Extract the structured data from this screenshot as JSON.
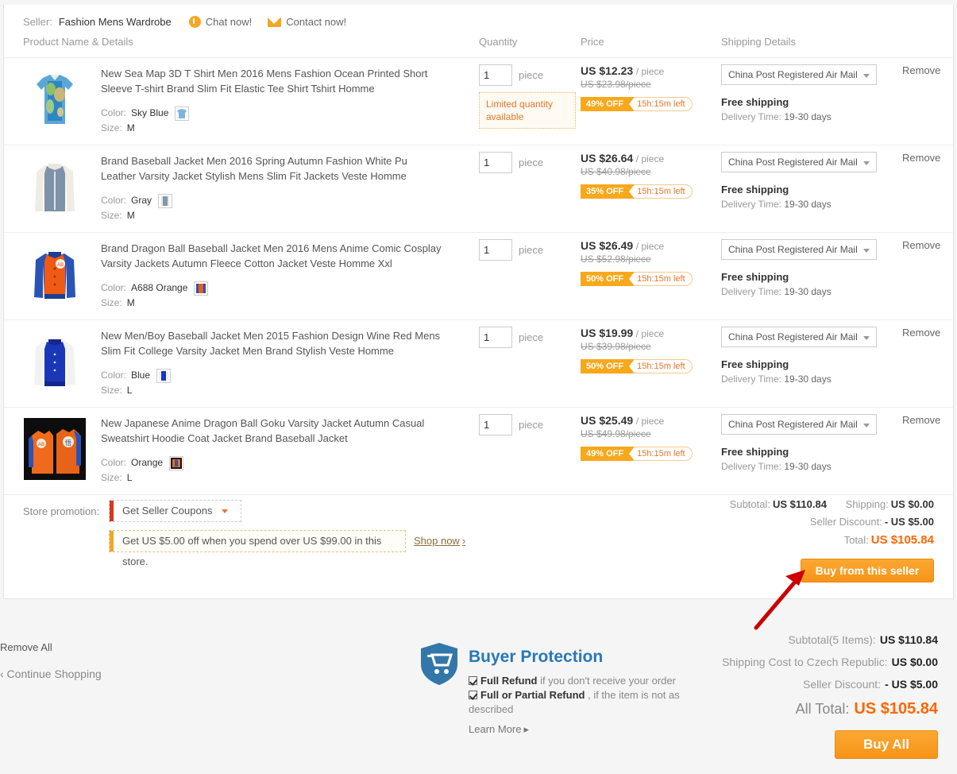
{
  "seller": {
    "label": "Seller:",
    "name": "Fashion Mens Wardrobe",
    "chat_label": "Chat now!",
    "contact_label": "Contact now!"
  },
  "columns": {
    "product": "Product Name & Details",
    "quantity": "Quantity",
    "price": "Price",
    "shipping": "Shipping Details"
  },
  "common": {
    "remove": "Remove",
    "unit": "piece",
    "per_piece": "/ piece",
    "free_shipping": "Free shipping",
    "delivery_key": "Delivery Time:",
    "delivery_value": "19-30 days",
    "color_key": "Color:",
    "size_key": "Size:",
    "limited_quantity": "Limited quantity available"
  },
  "items": [
    {
      "name": "New Sea Map 3D T Shirt Men 2016 Mens Fashion Ocean Printed Short Sleeve T-shirt Brand Slim Fit Elastic Tee Shirt Tshirt Homme",
      "color": "Sky Blue",
      "size": "M",
      "qty": "1",
      "price": "US $12.23",
      "original_price": "US $23.98/piece",
      "discount": "49% OFF",
      "time_left": "15h:15m left",
      "shipping_method": "China Post Registered Air Mail",
      "limited": true,
      "thumb": "tshirt-sea-map"
    },
    {
      "name": "Brand Baseball Jacket Men 2016 Spring Autumn Fashion White Pu Leather Varsity Jacket Stylish Mens Slim Fit Jackets Veste Homme",
      "color": "Gray",
      "size": "M",
      "qty": "1",
      "price": "US $26.64",
      "original_price": "US $40.98/piece",
      "discount": "35% OFF",
      "time_left": "15h:15m left",
      "shipping_method": "China Post Registered Air Mail",
      "limited": false,
      "thumb": "jacket-gray"
    },
    {
      "name": "Brand Dragon Ball Baseball Jacket Men 2016 Mens Anime Comic Cosplay Varsity Jackets Autumn Fleece Cotton Jacket Veste Homme Xxl",
      "color": "A688 Orange",
      "size": "M",
      "qty": "1",
      "price": "US $26.49",
      "original_price": "US $52.98/piece",
      "discount": "50% OFF",
      "time_left": "15h:15m left",
      "shipping_method": "China Post Registered Air Mail",
      "limited": false,
      "thumb": "jacket-orange-blue"
    },
    {
      "name": "New Men/Boy Baseball Jacket Men 2015 Fashion Design Wine Red Mens Slim Fit College Varsity Jacket Men Brand Stylish Veste Homme",
      "color": "Blue",
      "size": "L",
      "qty": "1",
      "price": "US $19.99",
      "original_price": "US $39.98/piece",
      "discount": "50% OFF",
      "time_left": "15h:15m left",
      "shipping_method": "China Post Registered Air Mail",
      "limited": false,
      "thumb": "jacket-blue-white"
    },
    {
      "name": "New Japanese Anime Dragon Ball Goku Varsity Jacket Autumn Casual Sweatshirt Hoodie Coat Jacket Brand Baseball Jacket",
      "color": "Orange",
      "size": "L",
      "qty": "1",
      "price": "US $25.49",
      "original_price": "US $49.98/piece",
      "discount": "49% OFF",
      "time_left": "15h:15m left",
      "shipping_method": "China Post Registered Air Mail",
      "limited": false,
      "thumb": "jacket-goku-dark"
    }
  ],
  "promotion": {
    "label": "Store promotion:",
    "coupon_button": "Get Seller Coupons",
    "offer_text": "Get US $5.00 off when you spend over US $99.00 in this store.",
    "shop_now": "Shop now"
  },
  "seller_totals": {
    "subtotal_key": "Subtotal:",
    "subtotal_value": "US $110.84",
    "shipping_key": "Shipping:",
    "shipping_value": "US $0.00",
    "discount_key": "Seller Discount:",
    "discount_value": "- US $5.00",
    "total_key": "Total:",
    "total_value": "US $105.84",
    "buy_button": "Buy from this seller"
  },
  "footer": {
    "remove_all": "Remove All",
    "continue_shopping": "‹ Continue Shopping"
  },
  "buyer_protection": {
    "title": "Buyer Protection",
    "item1_bold": "Full Refund",
    "item1_rest": "if you don't receive your order",
    "item2_bold": "Full or Partial Refund",
    "item2_rest": ", if the item is not as described",
    "learn_more": "Learn More"
  },
  "grand_totals": {
    "subtotal_key": "Subtotal(5 Items):",
    "subtotal_value": "US $110.84",
    "shipping_key": "Shipping Cost to Czech Republic:",
    "shipping_value": "US $0.00",
    "discount_key": "Seller Discount:",
    "discount_value": "- US $5.00",
    "total_key": "All Total:",
    "total_value": "US $105.84",
    "buy_all": "Buy All"
  },
  "colors": {
    "accent_orange": "#f60",
    "badge_orange": "#f7a81b",
    "protection_blue": "#2878b5",
    "annotation_red": "#cc0000"
  }
}
